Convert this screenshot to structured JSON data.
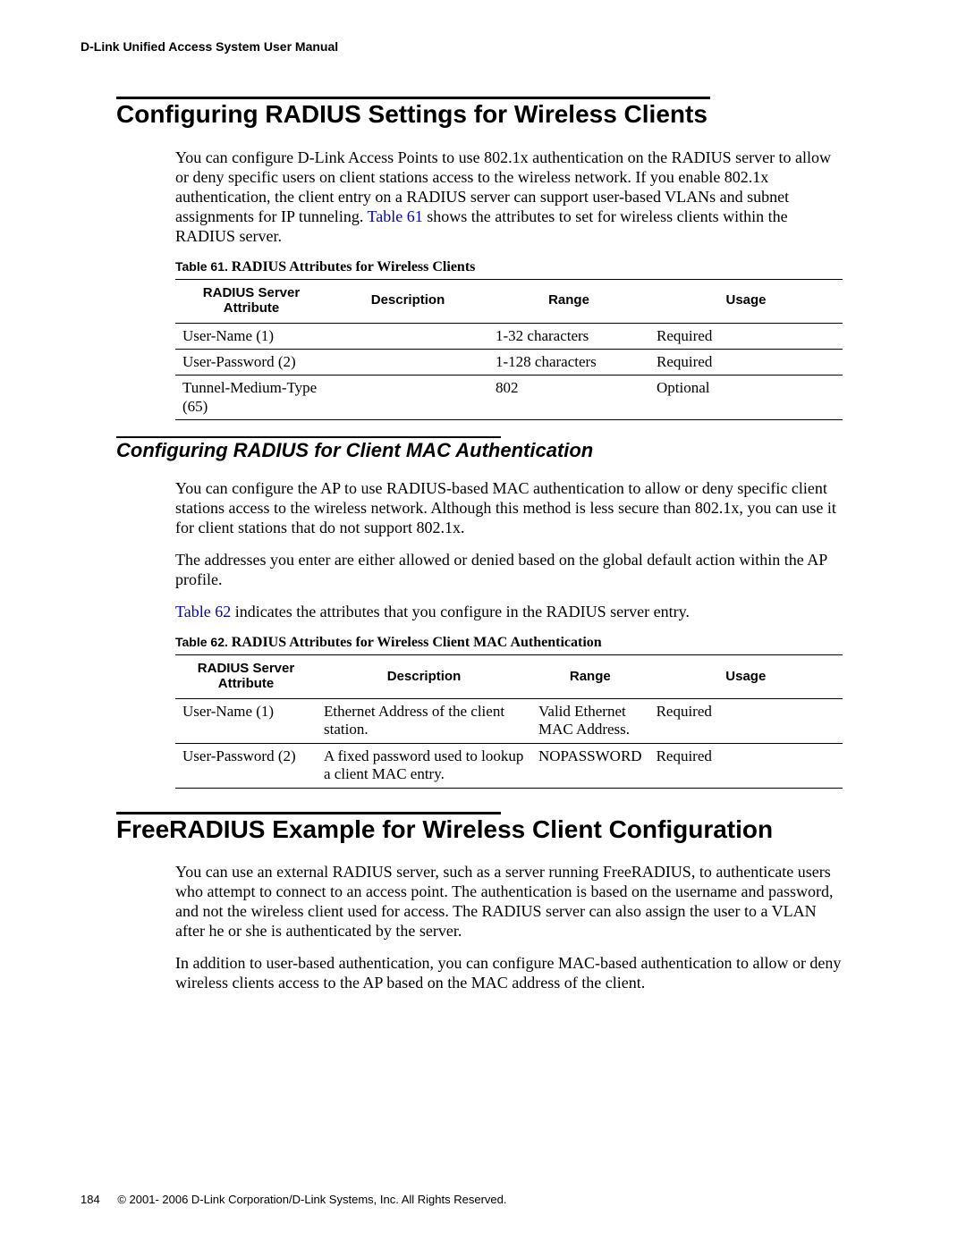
{
  "header": {
    "running_head": "D-Link Unified Access System User Manual"
  },
  "section1": {
    "title": "Configuring RADIUS Settings for Wireless Clients",
    "para_parts": {
      "a": "You can configure D-Link Access Points to use 802.1x authentication on the RADIUS server to allow or deny specific users on client stations access to the wireless network. If you enable 802.1x authentication, the client entry on a RADIUS server can support user-based VLANs and subnet assignments for IP tunneling. ",
      "xref": "Table 61",
      "b": " shows the attributes to set for wireless clients within the RADIUS server."
    },
    "table_caption_label": "Table 61. ",
    "table_caption_title": "RADIUS Attributes for Wireless Clients",
    "table_headers": [
      "RADIUS Server Attribute",
      "Description",
      "Range",
      "Usage"
    ],
    "rows": [
      {
        "attr": "User-Name (1)",
        "desc": "",
        "range": "1-32 characters",
        "usage": "Required"
      },
      {
        "attr": "User-Password (2)",
        "desc": "",
        "range": "1-128 characters",
        "usage": "Required"
      },
      {
        "attr": "Tunnel-Medium-Type (65)",
        "desc": "",
        "range": "802",
        "usage": "Optional"
      }
    ]
  },
  "section2": {
    "title": "Configuring RADIUS for Client MAC Authentication",
    "para1": "You can configure the AP to use RADIUS-based MAC authentication to allow or deny specific client stations access to the wireless network. Although this method is less secure than 802.1x, you can use it for client stations that do not support 802.1x.",
    "para2": "The addresses you enter are either allowed or denied based on the global default action within the AP profile.",
    "para3_parts": {
      "xref": "Table 62",
      "b": " indicates the attributes that you configure in the RADIUS server entry."
    },
    "table_caption_label": "Table 62. ",
    "table_caption_title": "RADIUS Attributes for Wireless Client MAC Authentication",
    "table_headers": [
      "RADIUS Server Attribute",
      "Description",
      "Range",
      "Usage"
    ],
    "rows": [
      {
        "attr": "User-Name (1)",
        "desc": "Ethernet Address of the client station.",
        "range": "Valid Ethernet MAC Address.",
        "usage": "Required"
      },
      {
        "attr": "User-Password (2)",
        "desc": "A fixed password used to lookup a client MAC entry.",
        "range": "NOPASSWORD",
        "usage": "Required"
      }
    ]
  },
  "section3": {
    "title": "FreeRADIUS Example for Wireless Client Configuration",
    "para1": "You can use an external RADIUS server, such as a server running FreeRADIUS, to authenticate users who attempt to connect to an access point. The authentication is based on the username and password, and not the wireless client used for access. The RADIUS server can also assign the user to a VLAN after he or she is authenticated by the server.",
    "para2": "In addition to user-based authentication, you can configure MAC-based authentication to allow or deny wireless clients access to the AP based on the MAC address of the client."
  },
  "footer": {
    "page_number": "184",
    "copyright": "© 2001- 2006 D-Link Corporation/D-Link Systems, Inc. All Rights Reserved."
  }
}
